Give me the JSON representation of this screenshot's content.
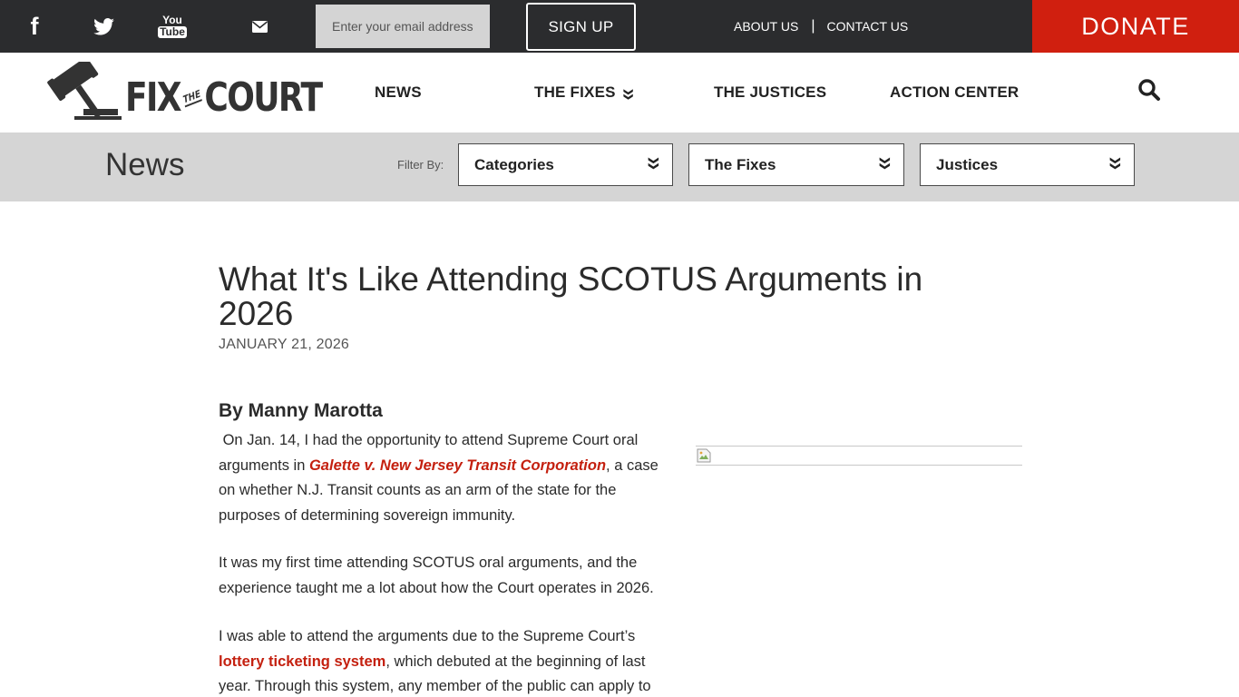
{
  "topbar": {
    "social": [
      {
        "name": "facebook-icon",
        "label": "f"
      },
      {
        "name": "twitter-icon",
        "label": ""
      },
      {
        "name": "youtube-icon",
        "label_top": "You",
        "label_bottom": "Tube"
      },
      {
        "name": "email-icon",
        "label": ""
      }
    ],
    "email_placeholder": "Enter your email address",
    "signup_label": "SIGN UP",
    "about_label": "ABOUT US",
    "separator": "|",
    "contact_label": "CONTACT US",
    "donate_label": "DONATE",
    "donate_color": "#d01f0f",
    "bar_color": "#2b2c2e"
  },
  "header": {
    "logo_fix": "FIX",
    "logo_the": "THE",
    "logo_court": "COURT",
    "nav": [
      {
        "label": "NEWS"
      },
      {
        "label": "THE FIXES",
        "chevron": "❯❯"
      },
      {
        "label": "THE JUSTICES"
      },
      {
        "label": "ACTION CENTER"
      }
    ]
  },
  "filterbar": {
    "title": "News",
    "filter_label": "Filter By:",
    "selects": [
      "Categories",
      "The Fixes",
      "Justices"
    ],
    "dropdown_glyph": "❯❯"
  },
  "article": {
    "title": "What It's Like Attending SCOTUS Arguments in 2026",
    "date": "JANUARY 21, 2026",
    "byline": "By Manny Marotta",
    "p1_a": " On Jan. 14, I had the opportunity to attend Supreme Court oral arguments in ",
    "p1_link": "Galette v. New Jersey Transit Corporation",
    "p1_b": ", a case on whether N.J. Transit counts as an arm of the state for the purposes of determining sovereign immunity.",
    "p2": "It was my first time attending SCOTUS oral arguments, and the experience taught me a lot about how the Court operates in 2026.",
    "p3_a": "I was able to attend the arguments due to the Supreme Court’s ",
    "p3_link": "lottery ticketing system",
    "p3_b": ", which debuted at the beginning of last year. Through this system, any member of the public can apply to",
    "link_color": "#c4200f"
  }
}
